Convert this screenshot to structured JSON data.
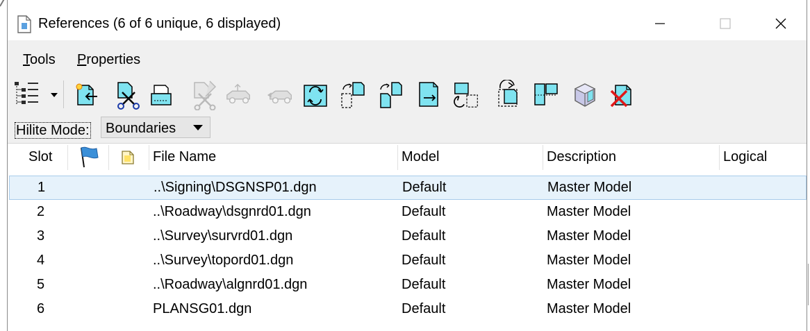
{
  "window": {
    "title": "References (6 of 6 unique, 6 displayed)"
  },
  "menu": {
    "items": [
      "Tools",
      "Properties"
    ]
  },
  "toolbar": {
    "icons": [
      "tree-list-icon",
      "attach-reference-icon",
      "detach-reference-icon",
      "reload-reference-icon",
      "cut-reference-icon",
      "move-reference-icon",
      "copy-reference-icon",
      "rotate-reference-icon",
      "scale-reference-icon",
      "mirror-horizontal-icon",
      "mirror-vertical-icon",
      "clip-boundary-icon",
      "clip-mask-icon",
      "clip-front-icon",
      "clip-delete-icon",
      "3d-reference-icon",
      "delete-clip-icon"
    ]
  },
  "hilite": {
    "label": "Hilite Mode:",
    "value": "Boundaries"
  },
  "table": {
    "columns": {
      "slot": "Slot",
      "flag": "",
      "file_icon": "",
      "file_name": "File Name",
      "model": "Model",
      "description": "Description",
      "logical": "Logical"
    },
    "rows": [
      {
        "slot": "1",
        "file": "..\\Signing\\DSGNSP01.dgn",
        "model": "Default",
        "description": "Master Model",
        "logical": ""
      },
      {
        "slot": "2",
        "file": "..\\Roadway\\dsgnrd01.dgn",
        "model": "Default",
        "description": "Master Model",
        "logical": ""
      },
      {
        "slot": "3",
        "file": "..\\Survey\\survrd01.dgn",
        "model": "Default",
        "description": "Master Model",
        "logical": ""
      },
      {
        "slot": "4",
        "file": "..\\Survey\\topord01.dgn",
        "model": "Default",
        "description": "Master Model",
        "logical": ""
      },
      {
        "slot": "5",
        "file": "..\\Roadway\\algnrd01.dgn",
        "model": "Default",
        "description": "Master Model",
        "logical": ""
      },
      {
        "slot": "6",
        "file": "PLANSG01.dgn",
        "model": "Default",
        "description": "Master Model",
        "logical": ""
      }
    ],
    "selected_row": 0
  },
  "colors": {
    "selected_row_bg": "#e6f2fb",
    "toolbar_bg": "#f0f0f0",
    "icon_cyan": "#7fe3f0",
    "flag_blue": "#3a8fd8"
  }
}
